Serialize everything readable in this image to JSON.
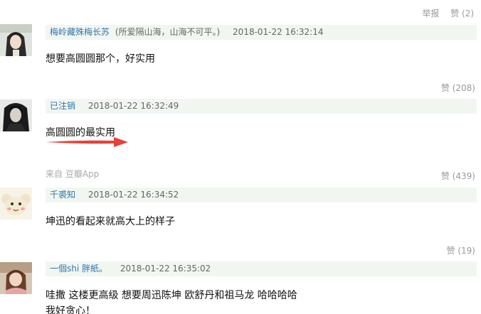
{
  "top_actions": {
    "report_label": "举报",
    "like_label": "赞",
    "like_count": "(2)"
  },
  "comments": [
    {
      "author": "梅岭藏殊梅长苏",
      "signature": "(所爱隔山海，山海不可平。)",
      "time": "2018-01-22 16:32:14",
      "text": "想要高圆圆那个，好实用",
      "vote_label": "赞",
      "vote_count": "(208)"
    },
    {
      "author": "已注销",
      "signature": "",
      "time": "2018-01-22 16:32:49",
      "text": "高圆圆的最实用",
      "source_prefix": "来自",
      "source_app": "豆瓣App",
      "vote_label": "赞",
      "vote_count": "(439)"
    },
    {
      "author": "千裘知",
      "signature": "",
      "time": "2018-01-22 16:34:52",
      "text": "坤迅的看起来就高大上的样子",
      "vote_label": "赞",
      "vote_count": "(19)"
    },
    {
      "author": "一個shi 胖紙。",
      "signature": "",
      "time": "2018-01-22 16:35:02",
      "text": "哇撒 这楼更高级 想要周迅陈坤 欧舒丹和祖马龙 哈哈哈哈",
      "text_line2": "我好贪心！"
    }
  ],
  "colors": {
    "author_link": "#3377aa",
    "meta_bar_bg": "#f1f6f1",
    "muted": "#999999",
    "arrow": "#e8403a"
  },
  "icons": [
    "red-arrow-annotation"
  ]
}
